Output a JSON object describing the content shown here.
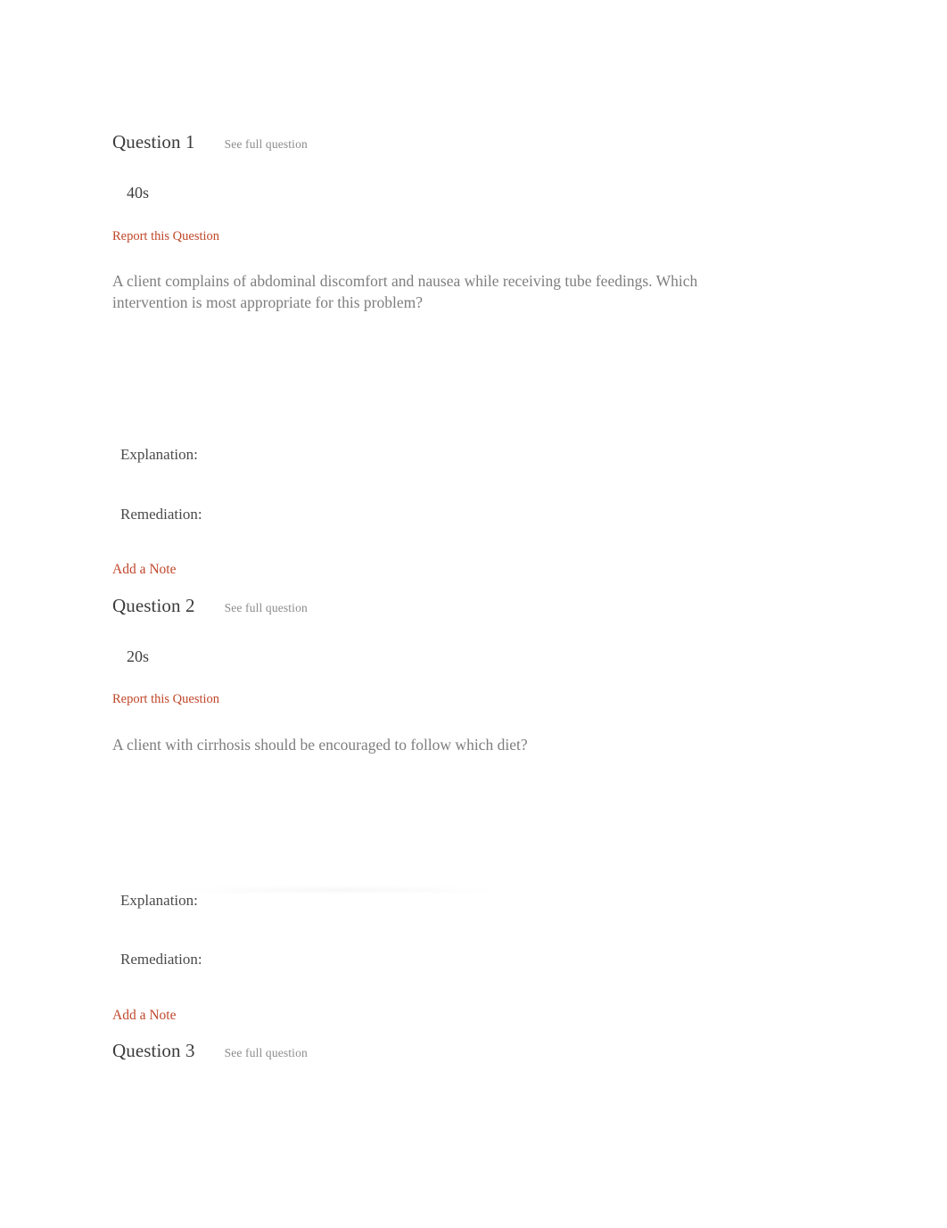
{
  "page": {
    "background_color": "#ffffff",
    "link_color": "#c0462a",
    "heading_color": "#3c3c3c",
    "muted_color": "#8c8c8c",
    "body_text_color": "#7e7e7e"
  },
  "questions": [
    {
      "title": "Question 1",
      "see_full_question": "See full question",
      "timer": "40s",
      "report_label": "Report this Question",
      "text": "A client complains of abdominal discomfort and nausea while receiving tube feedings. Which intervention is most appropriate for this problem?",
      "explanation_label": "Explanation:",
      "remediation_label": "Remediation:",
      "add_note_label": "Add a Note"
    },
    {
      "title": "Question 2",
      "see_full_question": "See full question",
      "timer": "20s",
      "report_label": "Report this Question",
      "text": "A client with cirrhosis should be encouraged to follow which diet?",
      "explanation_label": "Explanation:",
      "remediation_label": "Remediation:",
      "add_note_label": "Add a Note"
    },
    {
      "title": "Question 3",
      "see_full_question": "See full question"
    }
  ]
}
